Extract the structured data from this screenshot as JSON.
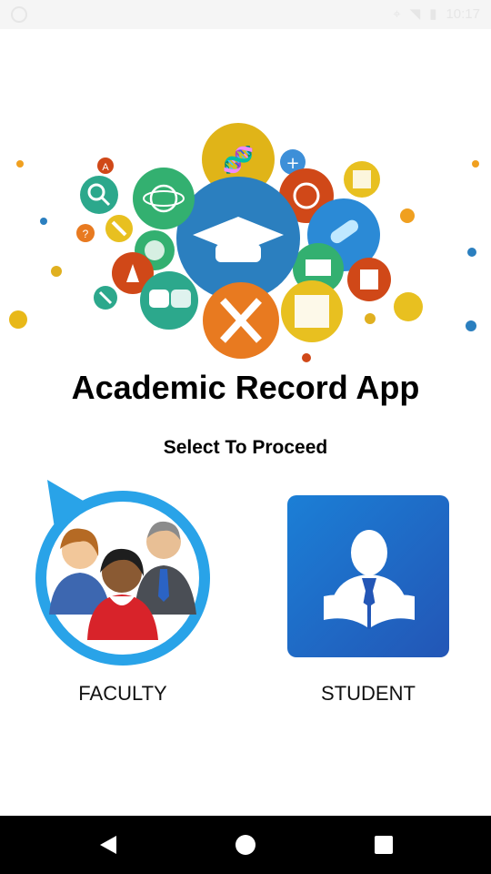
{
  "status_bar": {
    "time": "10:17"
  },
  "hero": {
    "alt_icon": "graduation-cap-icon"
  },
  "title": "Academic Record App",
  "subtitle": "Select To Proceed",
  "options": [
    {
      "label": "FACULTY",
      "icon": "faculty-group-icon"
    },
    {
      "label": "STUDENT",
      "icon": "student-reading-icon"
    }
  ],
  "colors": {
    "blue": "#2b7fbf",
    "student_tile": "#1f5fc0",
    "faculty_ring": "#29a3e8"
  }
}
